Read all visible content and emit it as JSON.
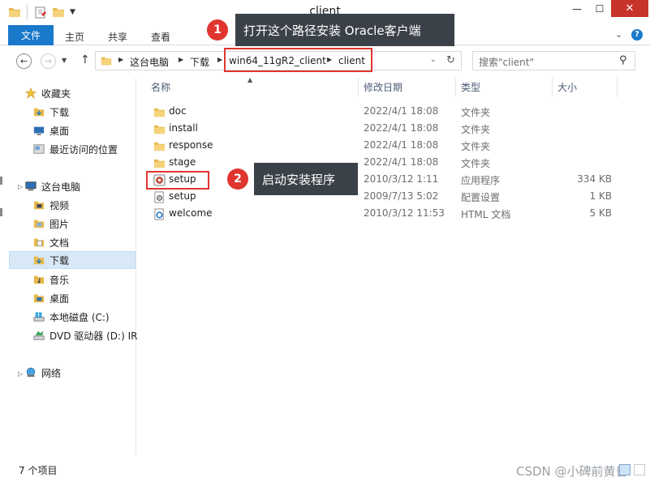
{
  "window": {
    "title": "client",
    "close_glyph": "✕",
    "max_glyph": "☐",
    "min_glyph": "—"
  },
  "ribbon": {
    "file": "文件",
    "home": "主页",
    "share": "共享",
    "view": "查看",
    "help": "?"
  },
  "nav": {
    "breadcrumbs": [
      "这台电脑",
      "下载",
      "win64_11gR2_client",
      "client"
    ],
    "search_placeholder": "搜索\"client\""
  },
  "sidebar": {
    "favorites_header": "收藏夹",
    "favorites": [
      "下载",
      "桌面",
      "最近访问的位置"
    ],
    "thispc_header": "这台电脑",
    "thispc": [
      "视频",
      "图片",
      "文档",
      "下载",
      "音乐",
      "桌面",
      "本地磁盘 (C:)",
      "DVD 驱动器 (D:) IR"
    ],
    "network": "网络"
  },
  "columns": {
    "name": "名称",
    "date": "修改日期",
    "type": "类型",
    "size": "大小"
  },
  "files": [
    {
      "name": "doc",
      "date": "2022/4/1 18:08",
      "type": "文件夹",
      "size": "",
      "icon": "folder-icon"
    },
    {
      "name": "install",
      "date": "2022/4/1 18:08",
      "type": "文件夹",
      "size": "",
      "icon": "folder-icon"
    },
    {
      "name": "response",
      "date": "2022/4/1 18:08",
      "type": "文件夹",
      "size": "",
      "icon": "folder-icon"
    },
    {
      "name": "stage",
      "date": "2022/4/1 18:08",
      "type": "文件夹",
      "size": "",
      "icon": "folder-icon"
    },
    {
      "name": "setup",
      "date": "2010/3/12 1:11",
      "type": "应用程序",
      "size": "334 KB",
      "icon": "setup-exe-icon"
    },
    {
      "name": "setup",
      "date": "2009/7/13 5:02",
      "type": "配置设置",
      "size": "1 KB",
      "icon": "config-file-icon"
    },
    {
      "name": "welcome",
      "date": "2010/3/12 11:53",
      "type": "HTML 文档",
      "size": "5 KB",
      "icon": "html-file-icon"
    }
  ],
  "annotations": {
    "callout1_num": "1",
    "callout1_text": "打开这个路径安装 Oracle客户端",
    "callout2_num": "2",
    "callout2_text": "启动安装程序"
  },
  "status": {
    "item_count": "7 个项目",
    "watermark": "CSDN @小碑前黄昏"
  },
  "colors": {
    "accent": "#1979ca",
    "annotation_red": "#e0352f",
    "callout_bg": "#3b4148",
    "folder": "#e8b84a"
  }
}
